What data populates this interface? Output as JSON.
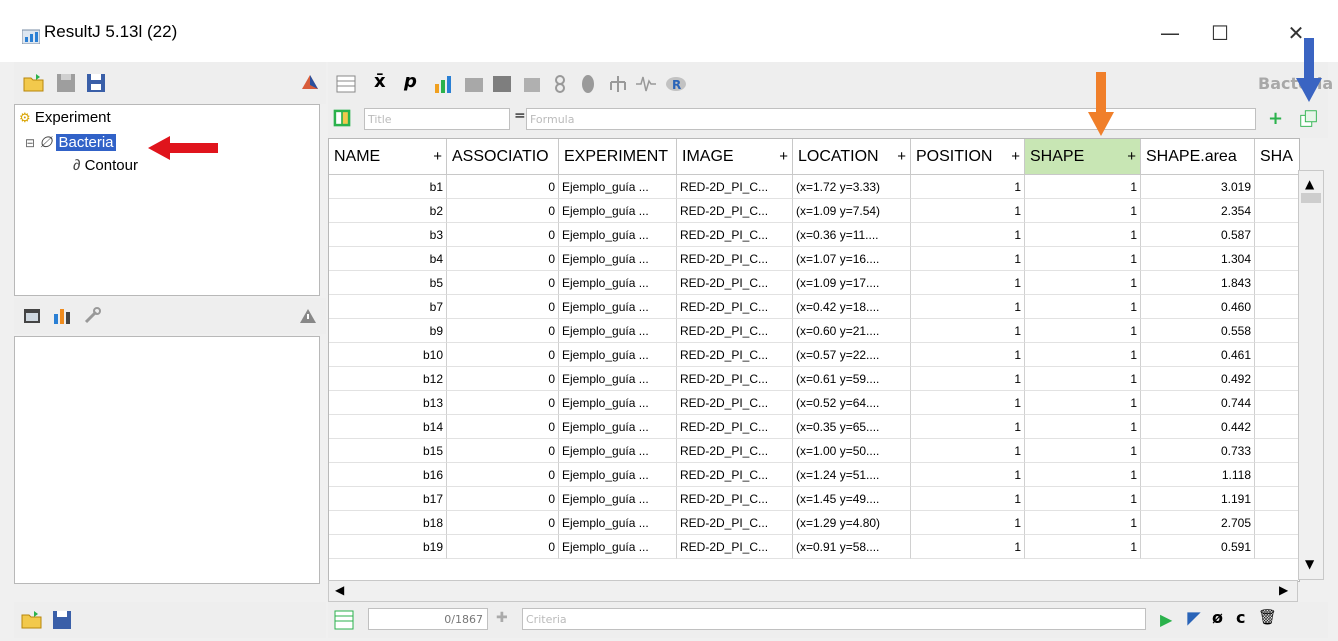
{
  "window": {
    "title": "ResultJ 5.13l (22)",
    "minimize": "—",
    "maximize": "☐",
    "close": "✕"
  },
  "right_toolbar": {
    "panel_label": "Bacteria"
  },
  "title_row": {
    "title_placeholder": "Title",
    "equals": "=",
    "formula_placeholder": "Formula"
  },
  "tree": {
    "root": "Experiment",
    "selected": "Bacteria",
    "child": "Contour"
  },
  "table": {
    "columns": [
      {
        "label": "NAME",
        "plus": "+"
      },
      {
        "label": "ASSOCIATIO",
        "plus": ""
      },
      {
        "label": "EXPERIMENT",
        "plus": ""
      },
      {
        "label": "IMAGE",
        "plus": "+"
      },
      {
        "label": "LOCATION",
        "plus": "+"
      },
      {
        "label": "POSITION",
        "plus": "+"
      },
      {
        "label": "SHAPE",
        "plus": "+"
      },
      {
        "label": "SHAPE.area",
        "plus": ""
      },
      {
        "label": "SHA",
        "plus": ""
      }
    ],
    "rows": [
      [
        "b1",
        "0",
        "Ejemplo_guía ...",
        "RED-2D_PI_C...",
        "(x=1.72 y=3.33)",
        "1",
        "1",
        "3.019"
      ],
      [
        "b2",
        "0",
        "Ejemplo_guía ...",
        "RED-2D_PI_C...",
        "(x=1.09 y=7.54)",
        "1",
        "1",
        "2.354"
      ],
      [
        "b3",
        "0",
        "Ejemplo_guía ...",
        "RED-2D_PI_C...",
        "(x=0.36 y=11....",
        "1",
        "1",
        "0.587"
      ],
      [
        "b4",
        "0",
        "Ejemplo_guía ...",
        "RED-2D_PI_C...",
        "(x=1.07 y=16....",
        "1",
        "1",
        "1.304"
      ],
      [
        "b5",
        "0",
        "Ejemplo_guía ...",
        "RED-2D_PI_C...",
        "(x=1.09 y=17....",
        "1",
        "1",
        "1.843"
      ],
      [
        "b7",
        "0",
        "Ejemplo_guía ...",
        "RED-2D_PI_C...",
        "(x=0.42 y=18....",
        "1",
        "1",
        "0.460"
      ],
      [
        "b9",
        "0",
        "Ejemplo_guía ...",
        "RED-2D_PI_C...",
        "(x=0.60 y=21....",
        "1",
        "1",
        "0.558"
      ],
      [
        "b10",
        "0",
        "Ejemplo_guía ...",
        "RED-2D_PI_C...",
        "(x=0.57 y=22....",
        "1",
        "1",
        "0.461"
      ],
      [
        "b12",
        "0",
        "Ejemplo_guía ...",
        "RED-2D_PI_C...",
        "(x=0.61 y=59....",
        "1",
        "1",
        "0.492"
      ],
      [
        "b13",
        "0",
        "Ejemplo_guía ...",
        "RED-2D_PI_C...",
        "(x=0.52 y=64....",
        "1",
        "1",
        "0.744"
      ],
      [
        "b14",
        "0",
        "Ejemplo_guía ...",
        "RED-2D_PI_C...",
        "(x=0.35 y=65....",
        "1",
        "1",
        "0.442"
      ],
      [
        "b15",
        "0",
        "Ejemplo_guía ...",
        "RED-2D_PI_C...",
        "(x=1.00 y=50....",
        "1",
        "1",
        "0.733"
      ],
      [
        "b16",
        "0",
        "Ejemplo_guía ...",
        "RED-2D_PI_C...",
        "(x=1.24 y=51....",
        "1",
        "1",
        "1.118"
      ],
      [
        "b17",
        "0",
        "Ejemplo_guía ...",
        "RED-2D_PI_C...",
        "(x=1.45 y=49....",
        "1",
        "1",
        "1.191"
      ],
      [
        "b18",
        "0",
        "Ejemplo_guía ...",
        "RED-2D_PI_C...",
        "(x=1.29 y=4.80)",
        "1",
        "1",
        "2.705"
      ],
      [
        "b19",
        "0",
        "Ejemplo_guía ...",
        "RED-2D_PI_C...",
        "(x=0.91 y=58....",
        "1",
        "1",
        "0.591"
      ]
    ]
  },
  "footer": {
    "count": "0/1867",
    "criteria_placeholder": "Criteria"
  },
  "colors": {
    "selection": "#3162c8",
    "shape_header": "#c8e6b4",
    "red_arrow": "#e0141c",
    "orange_arrow": "#f07f2a",
    "blue_arrow": "#3a64c2"
  }
}
